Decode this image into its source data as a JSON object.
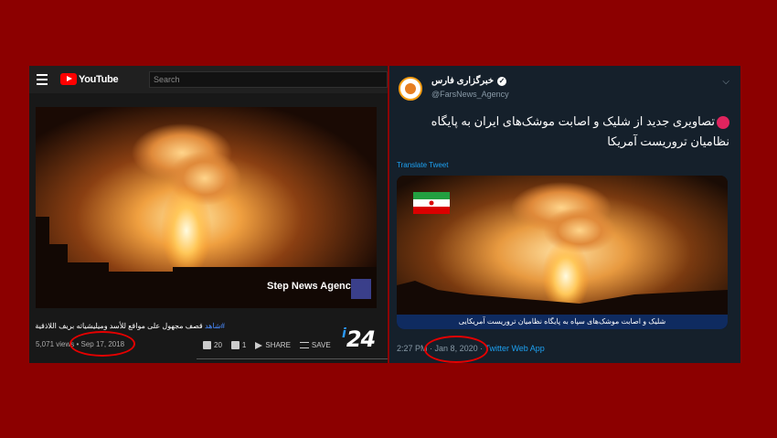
{
  "youtube": {
    "logo_text": "YouTube",
    "search_placeholder": "Search",
    "video_watermark": "Step News Agency",
    "title_tag": "#شاهد",
    "title_text": "قصف مجهول على مواقع للأسد وميليشياته بريف اللاذقية",
    "views": "5,071 views",
    "date": "Sep 17, 2018",
    "likes": "20",
    "dislikes": "1",
    "share_label": "SHARE",
    "save_label": "SAVE",
    "channel_logo": "24"
  },
  "twitter": {
    "account_name": "خبرگزاری فارس",
    "handle": "@FarsNews_Agency",
    "tweet_text": "تصاویری جدید از شلیک و اصابت موشک‌های ایران به پایگاه نظامیان تروریست آمریکا",
    "translate_label": "Translate Tweet",
    "media_caption": "شلیک و اصابت موشک‌های سپاه به پایگاه نظامیان تروریست آمریکایی",
    "time": "2:27 PM",
    "date": "Jan 8, 2020",
    "source": "Twitter Web App"
  },
  "colors": {
    "background": "#8c0000",
    "highlight_circle": "#e40000",
    "twitter_blue": "#1da1f2"
  }
}
